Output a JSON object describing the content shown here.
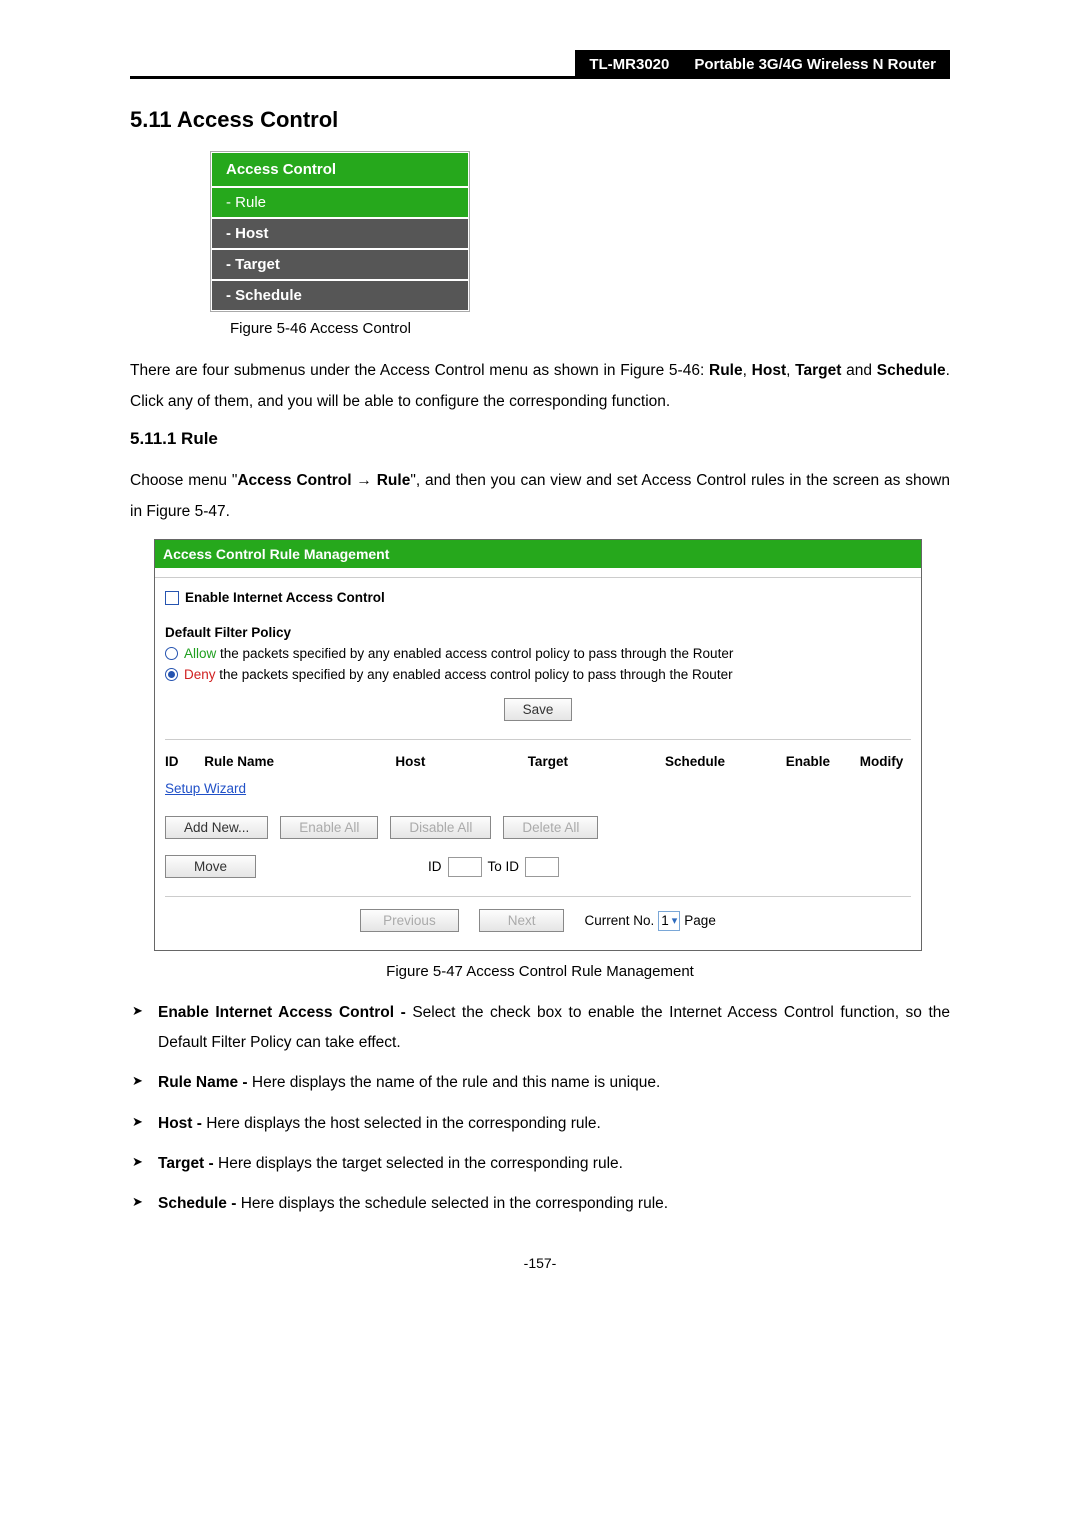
{
  "header": {
    "model": "TL-MR3020",
    "product": "Portable 3G/4G Wireless N Router"
  },
  "sections": {
    "h1": "5.11 Access Control",
    "h2": "5.11.1  Rule"
  },
  "menu": {
    "title": "Access Control",
    "items": [
      {
        "label": "- Rule",
        "active": true
      },
      {
        "label": "- Host",
        "active": false
      },
      {
        "label": "- Target",
        "active": false
      },
      {
        "label": "- Schedule",
        "active": false
      }
    ]
  },
  "figures": {
    "f46": "Figure 5-46    Access Control",
    "f47": "Figure 5-47    Access Control Rule Management"
  },
  "paragraphs": {
    "p1a": "There are four submenus under the Access Control menu as shown in Figure 5-46: ",
    "p1b": "Rule",
    "p1c": ", ",
    "p1d": "Host",
    "p1e": ", ",
    "p1f": "Target",
    "p1g": " and ",
    "p1h": "Schedule",
    "p1i": ". Click any of them, and you will be able to configure the corresponding function.",
    "p2a": "Choose menu \"",
    "p2b": "Access Control",
    "p2c": "  →  ",
    "p2d": "Rule",
    "p2e": "\", and then you can view and set Access Control rules in the screen as shown in Figure 5-47."
  },
  "screenshot": {
    "title": "Access Control Rule Management",
    "enable_label": "Enable Internet Access Control",
    "policy_title": "Default Filter Policy",
    "allow_word": "Allow",
    "allow_rest": " the packets specified by any enabled access control policy to pass through the Router",
    "deny_word": "Deny",
    "deny_rest": " the packets specified by any enabled access control policy to pass through the Router",
    "save": "Save",
    "headers": {
      "id": "ID",
      "rule": "Rule Name",
      "host": "Host",
      "target": "Target",
      "schedule": "Schedule",
      "enable": "Enable",
      "modify": "Modify"
    },
    "setup_wizard": "Setup Wizard",
    "add_new": "Add New...",
    "enable_all": "Enable All",
    "disable_all": "Disable All",
    "delete_all": "Delete All",
    "move": "Move",
    "id_lbl": "ID",
    "to_id": "To ID",
    "previous": "Previous",
    "next": "Next",
    "current_no": "Current No.",
    "page_val": "1",
    "page_lbl": "Page"
  },
  "bullets": [
    {
      "b": "Enable Internet Access Control -",
      "t": " Select the check box to enable the Internet Access Control function, so the Default Filter Policy can take effect."
    },
    {
      "b": "Rule Name -",
      "t": " Here displays the name of the rule and this name is unique."
    },
    {
      "b": "Host -",
      "t": " Here displays the host selected in the corresponding rule."
    },
    {
      "b": "Target -",
      "t": " Here displays the target selected in the corresponding rule."
    },
    {
      "b": "Schedule -",
      "t": " Here displays the schedule selected in the corresponding rule."
    }
  ],
  "page_number": "-157-"
}
